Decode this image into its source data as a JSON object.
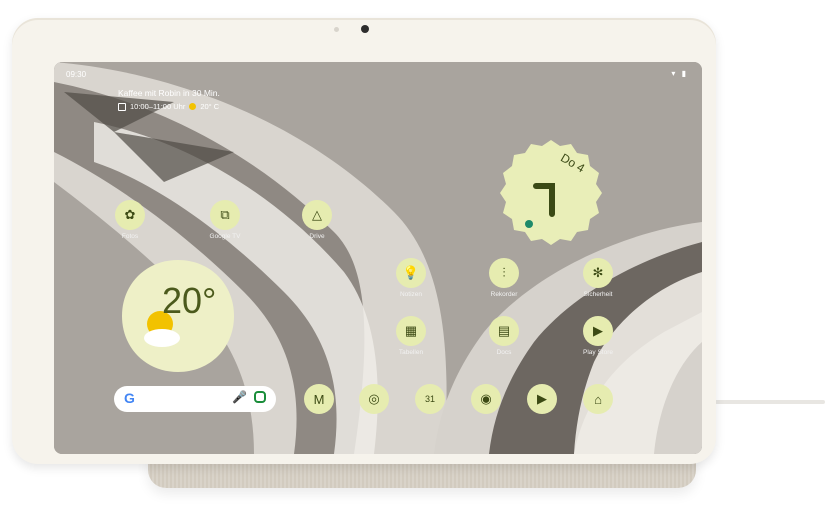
{
  "status": {
    "time": "09:30",
    "icons": "▾ ▮"
  },
  "event": {
    "title": "Kaffee mit Robin in 30 Min.",
    "time": "10:00–11:00 Uhr",
    "temp": "20° C"
  },
  "clock": {
    "date": "Do 4"
  },
  "weather": {
    "temp": "20°"
  },
  "apps": [
    {
      "label": "Fotos",
      "icon": "pinwheel-icon",
      "glyph": "✿"
    },
    {
      "label": "Google TV",
      "icon": "tv-icon",
      "glyph": "⧉"
    },
    {
      "label": "Drive",
      "icon": "drive-icon",
      "glyph": "△"
    },
    {
      "label": "Notizen",
      "icon": "lightbulb-icon",
      "glyph": "💡"
    },
    {
      "label": "Rekorder",
      "icon": "waveform-icon",
      "glyph": "⫶"
    },
    {
      "label": "Sicherheit",
      "icon": "shield-icon",
      "glyph": "✻"
    },
    {
      "label": "Tabellen",
      "icon": "sheets-icon",
      "glyph": "▦"
    },
    {
      "label": "Docs",
      "icon": "docs-icon",
      "glyph": "▤"
    },
    {
      "label": "Play Store",
      "icon": "play-store-icon",
      "glyph": "▶"
    }
  ],
  "dock_apps": [
    {
      "name": "gmail",
      "icon": "mail-icon",
      "glyph": "M"
    },
    {
      "name": "chrome",
      "icon": "chrome-icon",
      "glyph": "◎"
    },
    {
      "name": "calendar",
      "icon": "calendar-icon",
      "glyph": "31"
    },
    {
      "name": "camera",
      "icon": "camera-icon",
      "glyph": "◉"
    },
    {
      "name": "youtube",
      "icon": "youtube-icon",
      "glyph": "▶"
    },
    {
      "name": "home",
      "icon": "home-icon",
      "glyph": "⌂"
    }
  ],
  "search": {
    "logo": "G",
    "mic": "🎤"
  },
  "colors": {
    "frame": "#f6f3ec",
    "wallpaper": "#a7a29c",
    "icon_bg": "#e6ecb0",
    "icon_fg": "#3c4a14"
  }
}
